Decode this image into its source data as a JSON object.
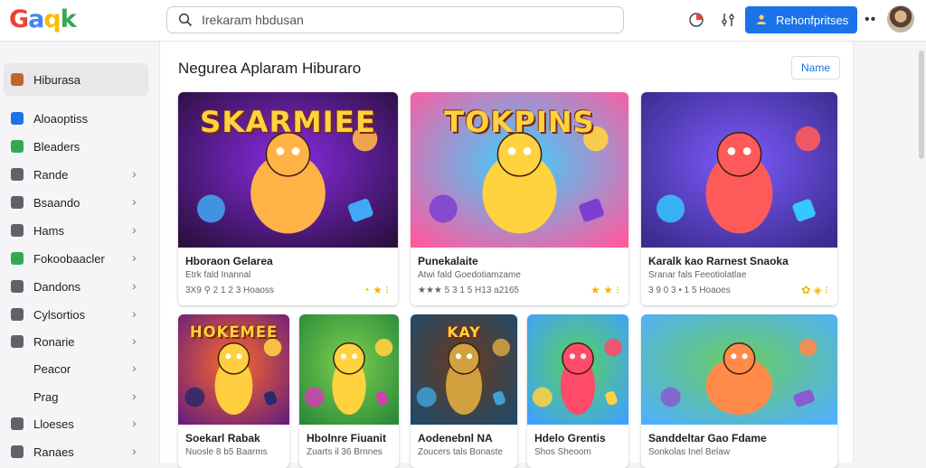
{
  "header": {
    "logo": [
      "G",
      "a",
      "q",
      "k"
    ],
    "search_placeholder": "Irekaram hbdusan",
    "signin_label": "Rehonfpritses"
  },
  "sidebar": {
    "items": [
      {
        "label": "Hiburasa",
        "icon": "person-icon",
        "color": "#c9612c",
        "active": true,
        "chevron": false
      },
      {
        "label": "Aloaoptiss",
        "icon": "shield-icon",
        "color": "#1a73e8",
        "chevron": false
      },
      {
        "label": "Bleaders",
        "icon": "grid-icon",
        "color": "#34a853",
        "chevron": false
      },
      {
        "label": "Rande",
        "icon": "box-icon",
        "color": "#5f6368",
        "chevron": true
      },
      {
        "label": "Bsaando",
        "icon": "folder-icon",
        "color": "#5f6368",
        "chevron": true
      },
      {
        "label": "Hams",
        "icon": "tv-icon",
        "color": "#5f6368",
        "chevron": true
      },
      {
        "label": "Fokoobaacler",
        "icon": "puzzle-icon",
        "color": "#34a853",
        "chevron": true
      },
      {
        "label": "Dandons",
        "icon": "house-icon",
        "color": "#5f6368",
        "chevron": true
      },
      {
        "label": "Cylsortios",
        "icon": "tag-icon",
        "color": "#5f6368",
        "chevron": true
      },
      {
        "label": "Ronarie",
        "icon": "calendar-icon",
        "color": "#5f6368",
        "chevron": true
      },
      {
        "label": "Peacor",
        "icon": "",
        "color": "",
        "chevron": true
      },
      {
        "label": "Prag",
        "icon": "",
        "color": "",
        "chevron": true
      },
      {
        "label": "Lloeses",
        "icon": "folder-icon",
        "color": "#5f6368",
        "chevron": true
      },
      {
        "label": "Ranaes",
        "icon": "gear-icon",
        "color": "#5f6368",
        "chevron": true
      }
    ]
  },
  "main": {
    "section_title": "Negurea Aplaram Hiburaro",
    "name_button": "Name"
  },
  "cards": [
    {
      "thumb_text": "SKARMIEE",
      "title": "Hboraon Gelarea",
      "meta": "Etrk fald Inannal",
      "stats": "3X9 ⚲ 2 1 2 3 Hoaoss",
      "icons": "◔ ★ ⁝"
    },
    {
      "thumb_text": "TOKPINS",
      "title": "Punekalaite",
      "meta": "Atwi fald Goedotiamzame",
      "stats": "★★★ 5 3 1 5 H13 a2165",
      "icons": "★ ★ ⁝"
    },
    {
      "thumb_text": "",
      "title": "Karalk kao Rarnest Snaoka",
      "meta": "Sranar fals Feeotiolatlae",
      "stats": "3 9 0 3 • 1 5 Hoaoes",
      "icons": "✿ ◈ ⁝"
    },
    {
      "thumb_text": "HOKEMEE",
      "title": "Soekarl Rabak",
      "meta": "Nuosle 8 b5 Baarms",
      "stats": "",
      "icons": ""
    },
    {
      "thumb_text": "",
      "title": "Hbolnre Fiuanit",
      "meta": "Zuarts il 36 Brnnes",
      "stats": "",
      "icons": ""
    },
    {
      "thumb_text": "KAY",
      "title": "Aodenebnl NA",
      "meta": "Zoucers tals Bonaste",
      "stats": "",
      "icons": ""
    },
    {
      "thumb_text": "",
      "title": "Hdelo Grentis",
      "meta": "Shos Sheoom",
      "stats": "",
      "icons": ""
    },
    {
      "thumb_text": "",
      "title": "Sanddeltar Gao Fdame",
      "meta": "Sonkolas Inel Belaw",
      "stats": "",
      "icons": ""
    }
  ]
}
